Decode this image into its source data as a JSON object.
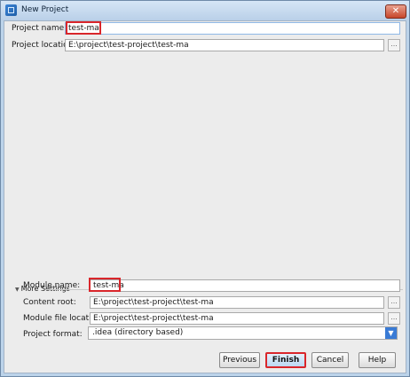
{
  "window": {
    "title": "New Project",
    "close_glyph": "✕",
    "icon": "intellij-app-icon"
  },
  "form": {
    "project_name_label": "Project name:",
    "project_name_value": "test-ma",
    "project_location_label": "Project location:",
    "project_location_value": "E:\\project\\test-project\\test-ma",
    "browse_glyph": "..."
  },
  "more_settings": {
    "toggle_glyph": "▼",
    "title": "More Settings",
    "module_name_label": "Module name:",
    "module_name_value": "test-ma",
    "content_root_label": "Content root:",
    "content_root_value": "E:\\project\\test-project\\test-ma",
    "module_file_location_label": "Module file location:",
    "module_file_location_value": "E:\\project\\test-project\\test-ma",
    "project_format_label": "Project format:",
    "project_format_value": ".idea (directory based)",
    "dropdown_glyph": "▼"
  },
  "buttons": {
    "previous": "Previous",
    "finish": "Finish",
    "cancel": "Cancel",
    "help": "Help"
  },
  "colors": {
    "highlight": "#d9262b",
    "accent": "#3a7bd5"
  }
}
